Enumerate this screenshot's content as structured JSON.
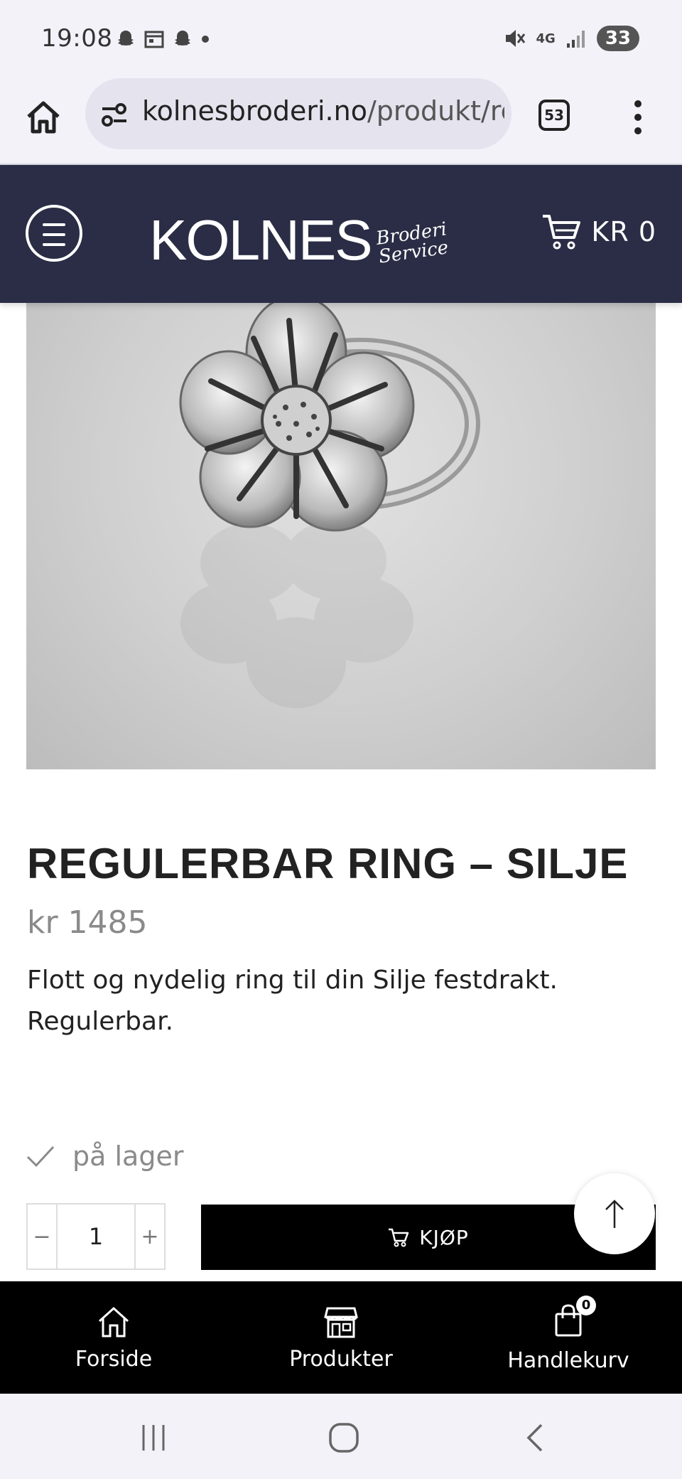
{
  "status_bar": {
    "time": "19:08",
    "network": "4G",
    "battery": "33"
  },
  "browser": {
    "url_domain": "kolnesbroderi.no",
    "url_path": "/produkt/re",
    "tab_count": "53"
  },
  "header": {
    "logo_main": "KOLNES",
    "logo_sub_1": "Broderi",
    "logo_sub_2": "Service",
    "cart_total": "KR 0"
  },
  "product": {
    "title": "REGULERBAR RING – SILJE",
    "price": "kr 1485",
    "description": "Flott og nydelig ring til din Silje festdrakt. Regulerbar.",
    "stock": "på lager",
    "quantity": "1",
    "buy_label": "KJØP"
  },
  "bottom_nav": {
    "items": [
      {
        "label": "Forside",
        "icon": "home-icon"
      },
      {
        "label": "Produkter",
        "icon": "store-icon"
      },
      {
        "label": "Handlekurv",
        "icon": "shopping-bag-icon"
      }
    ],
    "cart_count": "0"
  },
  "colors": {
    "header_bg": "#2a2d45",
    "buy_bg": "#000000",
    "price_gray": "#8a8a8a"
  }
}
